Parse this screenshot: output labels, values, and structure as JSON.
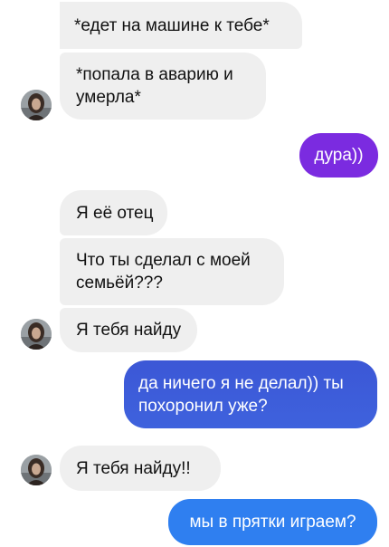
{
  "conversation": {
    "messages": [
      {
        "text": "*едет на машине к тебе*",
        "side": "incoming"
      },
      {
        "text": "*попала в аварию и\nумерла*",
        "side": "incoming"
      },
      {
        "text": "дура))",
        "side": "outgoing"
      },
      {
        "text": "Я её отец",
        "side": "incoming"
      },
      {
        "text": "Что ты сделал с моей\nсемьёй???",
        "side": "incoming"
      },
      {
        "text": "Я тебя найду",
        "side": "incoming"
      },
      {
        "text": "да ничего я не делал)) ты\nпохоронил уже?",
        "side": "outgoing"
      },
      {
        "text": "Я тебя найду!!",
        "side": "incoming"
      },
      {
        "text": "мы в прятки играем?",
        "side": "outgoing"
      }
    ]
  },
  "colors": {
    "incoming_bubble": "#efefef",
    "outgoing_purple": "#7b2be0",
    "outgoing_blue": "#3d5bd9",
    "outgoing_blue_light": "#2f7ff0"
  },
  "avatar": {
    "icon": "profile-photo-icon"
  }
}
